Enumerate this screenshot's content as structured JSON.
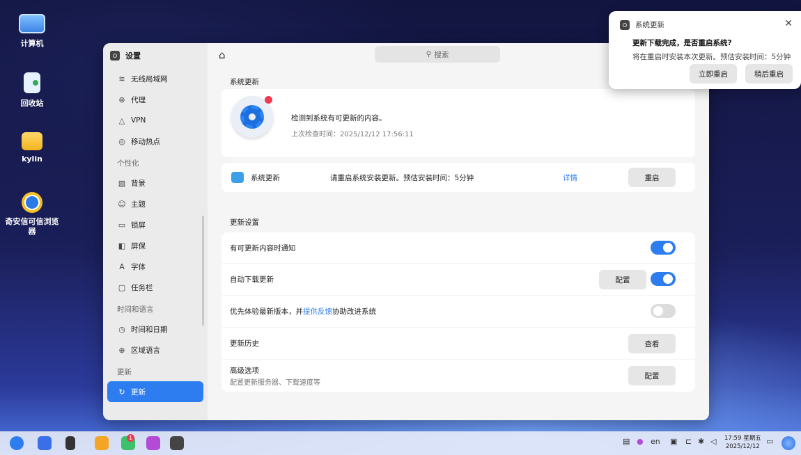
{
  "desktop": {
    "icons": [
      {
        "label": "计算机"
      },
      {
        "label": "回收站"
      },
      {
        "label": "kylin"
      },
      {
        "label": "奇安信可信浏览器"
      }
    ]
  },
  "window": {
    "title": "设置",
    "search_placeholder": "搜索",
    "sidebar": {
      "items_top": [
        {
          "icon": "wifi-icon",
          "label": "无线局域网"
        },
        {
          "icon": "proxy-icon",
          "label": "代理"
        },
        {
          "icon": "vpn-icon",
          "label": "VPN"
        },
        {
          "icon": "hotspot-icon",
          "label": "移动热点"
        }
      ],
      "section_personal": "个性化",
      "items_personal": [
        {
          "icon": "background-icon",
          "label": "背景"
        },
        {
          "icon": "theme-icon",
          "label": "主题"
        },
        {
          "icon": "lockscreen-icon",
          "label": "锁屏"
        },
        {
          "icon": "screensaver-icon",
          "label": "屏保"
        },
        {
          "icon": "font-icon",
          "label": "字体"
        },
        {
          "icon": "taskbar-icon",
          "label": "任务栏"
        }
      ],
      "section_time": "时间和语言",
      "items_time": [
        {
          "icon": "clock-icon",
          "label": "时间和日期"
        },
        {
          "icon": "globe-icon",
          "label": "区域语言"
        }
      ],
      "section_update": "更新",
      "active_item": {
        "icon": "refresh-icon",
        "label": "更新"
      }
    },
    "main": {
      "section_system_update": "系统更新",
      "status": {
        "message": "检测到系统有可更新的内容。",
        "last_check": "上次检查时间：2025/12/12 17:56:11"
      },
      "update_item": {
        "name": "系统更新",
        "message": "请重启系统安装更新。预估安装时间：5分钟",
        "details_link": "详情",
        "restart_button": "重启"
      },
      "section_update_settings": "更新设置",
      "settings": {
        "notify_label": "有可更新内容时通知",
        "notify_on": true,
        "auto_download_label": "自动下载更新",
        "auto_download_config": "配置",
        "auto_download_on": true,
        "preview_prefix": "优先体验最新版本，并",
        "preview_link": "提供反馈",
        "preview_suffix": "协助改进系统",
        "preview_on": false,
        "history_label": "更新历史",
        "history_button": "查看",
        "advanced_label": "高级选项",
        "advanced_sub": "配置更新服务器、下载速度等",
        "advanced_button": "配置"
      }
    }
  },
  "notification": {
    "app": "系统更新",
    "title": "更新下载完成，是否重启系统?",
    "body": "将在重启时安装本次更新。预估安装时间：5分钟",
    "restart_now": "立即重启",
    "restart_later": "稍后重启"
  },
  "taskbar": {
    "badge_count": "1",
    "lang": "en",
    "time": "17:59 星期五",
    "date": "2025/12/12"
  }
}
